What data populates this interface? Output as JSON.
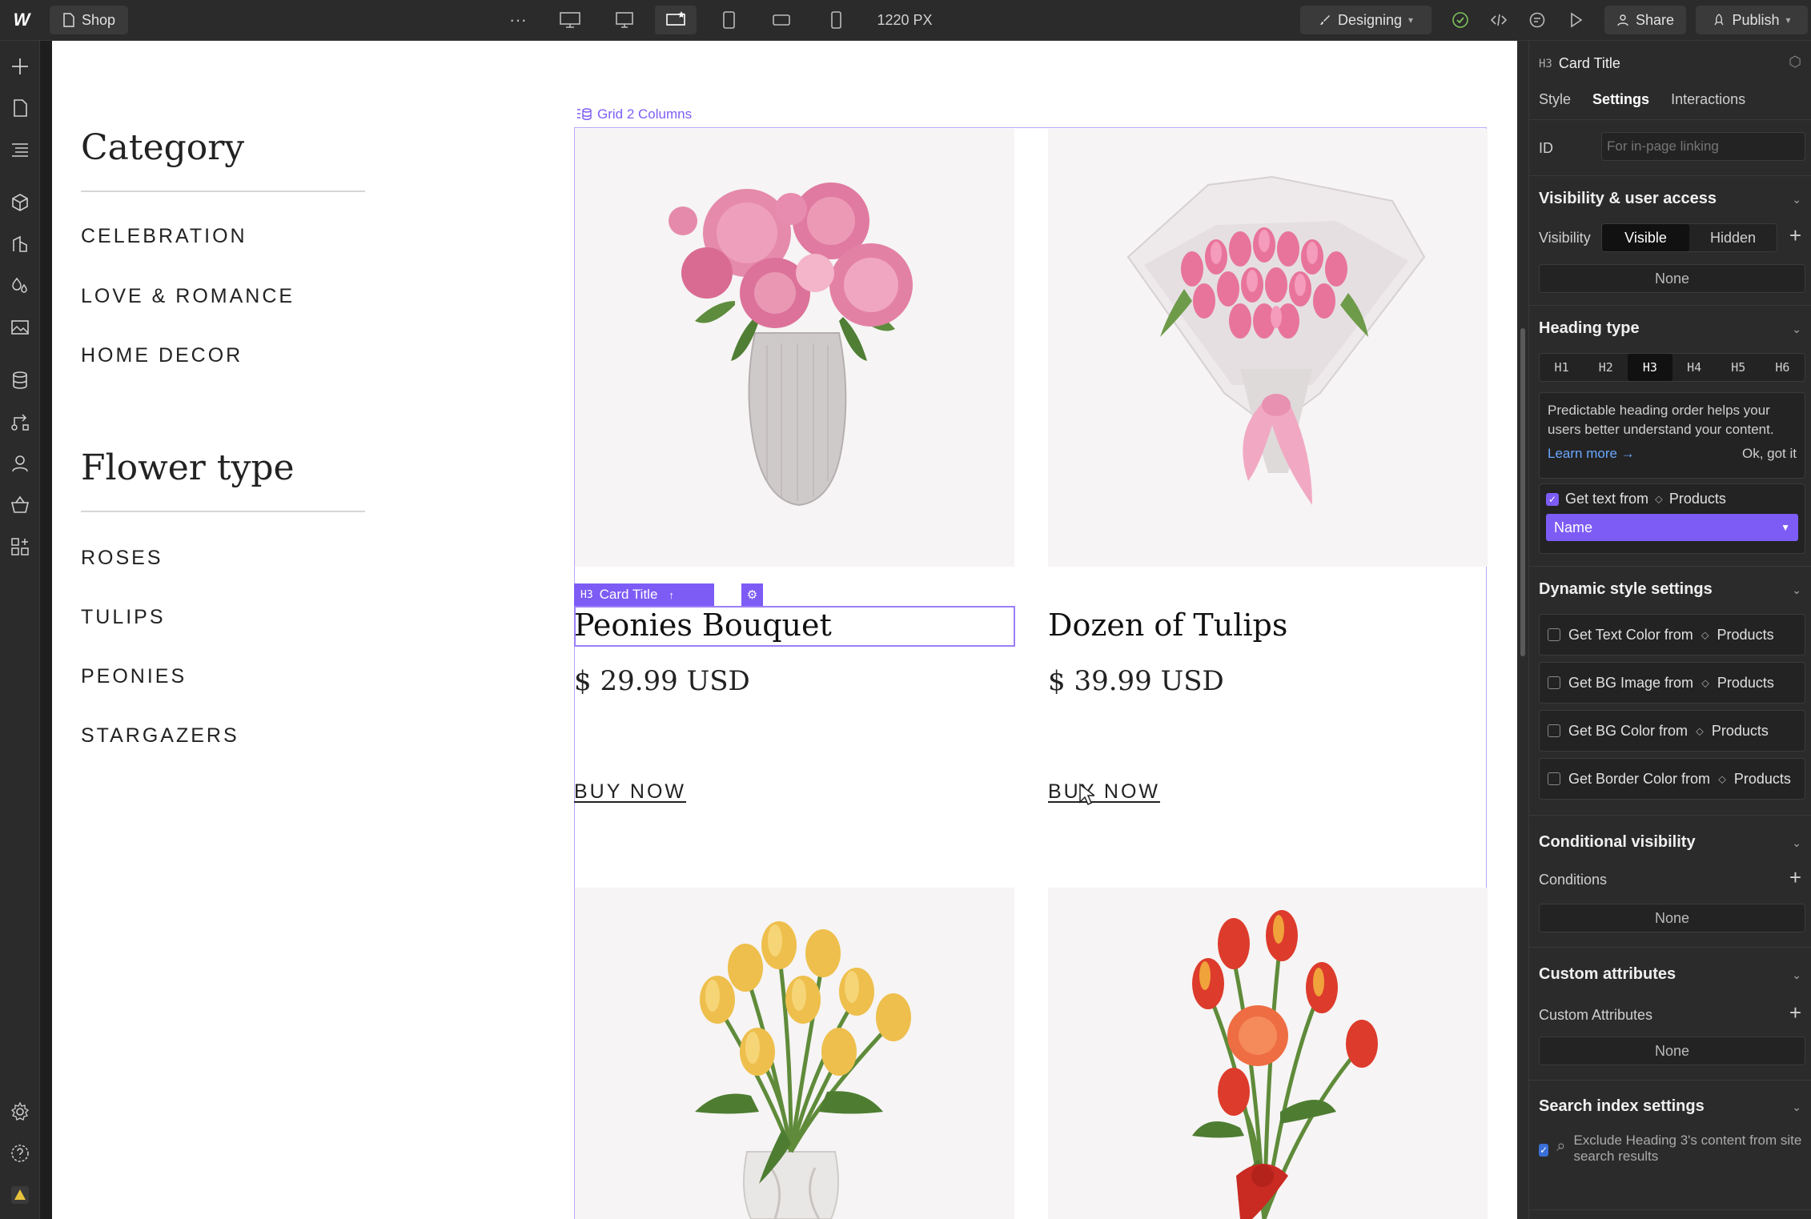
{
  "topbar": {
    "page_name": "Shop",
    "more": "···",
    "width_readout": "1220 PX",
    "mode": "Designing",
    "share": "Share",
    "publish": "Publish"
  },
  "canvas": {
    "category_heading": "Category",
    "categories": [
      "CELEBRATION",
      "LOVE & ROMANCE",
      "HOME DECOR"
    ],
    "flower_heading": "Flower type",
    "flower_types": [
      "ROSES",
      "TULIPS",
      "PEONIES",
      "STARGAZERS"
    ],
    "grid_label": "Grid 2 Columns",
    "selection_tag": "Card Title",
    "selection_tag_prefix": "H3",
    "products": [
      {
        "name": "Peonies Bouquet",
        "price": "$ 29.99 USD",
        "link": "BUY NOW"
      },
      {
        "name": "Dozen of Tulips",
        "price": "$ 39.99 USD",
        "link": "BUY NOW"
      }
    ]
  },
  "panel": {
    "element_prefix": "H3",
    "element_name": "Card Title",
    "tabs": [
      "Style",
      "Settings",
      "Interactions"
    ],
    "active_tab": "Settings",
    "id_label": "ID",
    "id_placeholder": "For in-page linking",
    "visibility_section": "Visibility & user access",
    "visibility_label": "Visibility",
    "visibility_options": [
      "Visible",
      "Hidden"
    ],
    "visibility_none": "None",
    "heading_section": "Heading type",
    "heading_levels": [
      "H1",
      "H2",
      "H3",
      "H4",
      "H5",
      "H6"
    ],
    "heading_active": "H3",
    "heading_tip": "Predictable heading order helps your users better understand your content.",
    "learn_more": "Learn more →",
    "ok_got_it": "Ok, got it",
    "get_text_from": "Get text from",
    "collection": "Products",
    "field_value": "Name",
    "dynamic_section": "Dynamic style settings",
    "dynamic_rows": [
      "Get Text Color from",
      "Get BG Image from",
      "Get BG Color from",
      "Get Border Color from"
    ],
    "conditional_section": "Conditional visibility",
    "conditions_label": "Conditions",
    "conditions_none": "None",
    "custom_section": "Custom attributes",
    "custom_label": "Custom Attributes",
    "custom_none": "None",
    "search_section": "Search index settings",
    "search_text": "Exclude Heading 3's content from site search results"
  },
  "colors": {
    "accent": "#7d5cf5",
    "chrome": "#2b2b2b",
    "success": "#7ec15a"
  }
}
